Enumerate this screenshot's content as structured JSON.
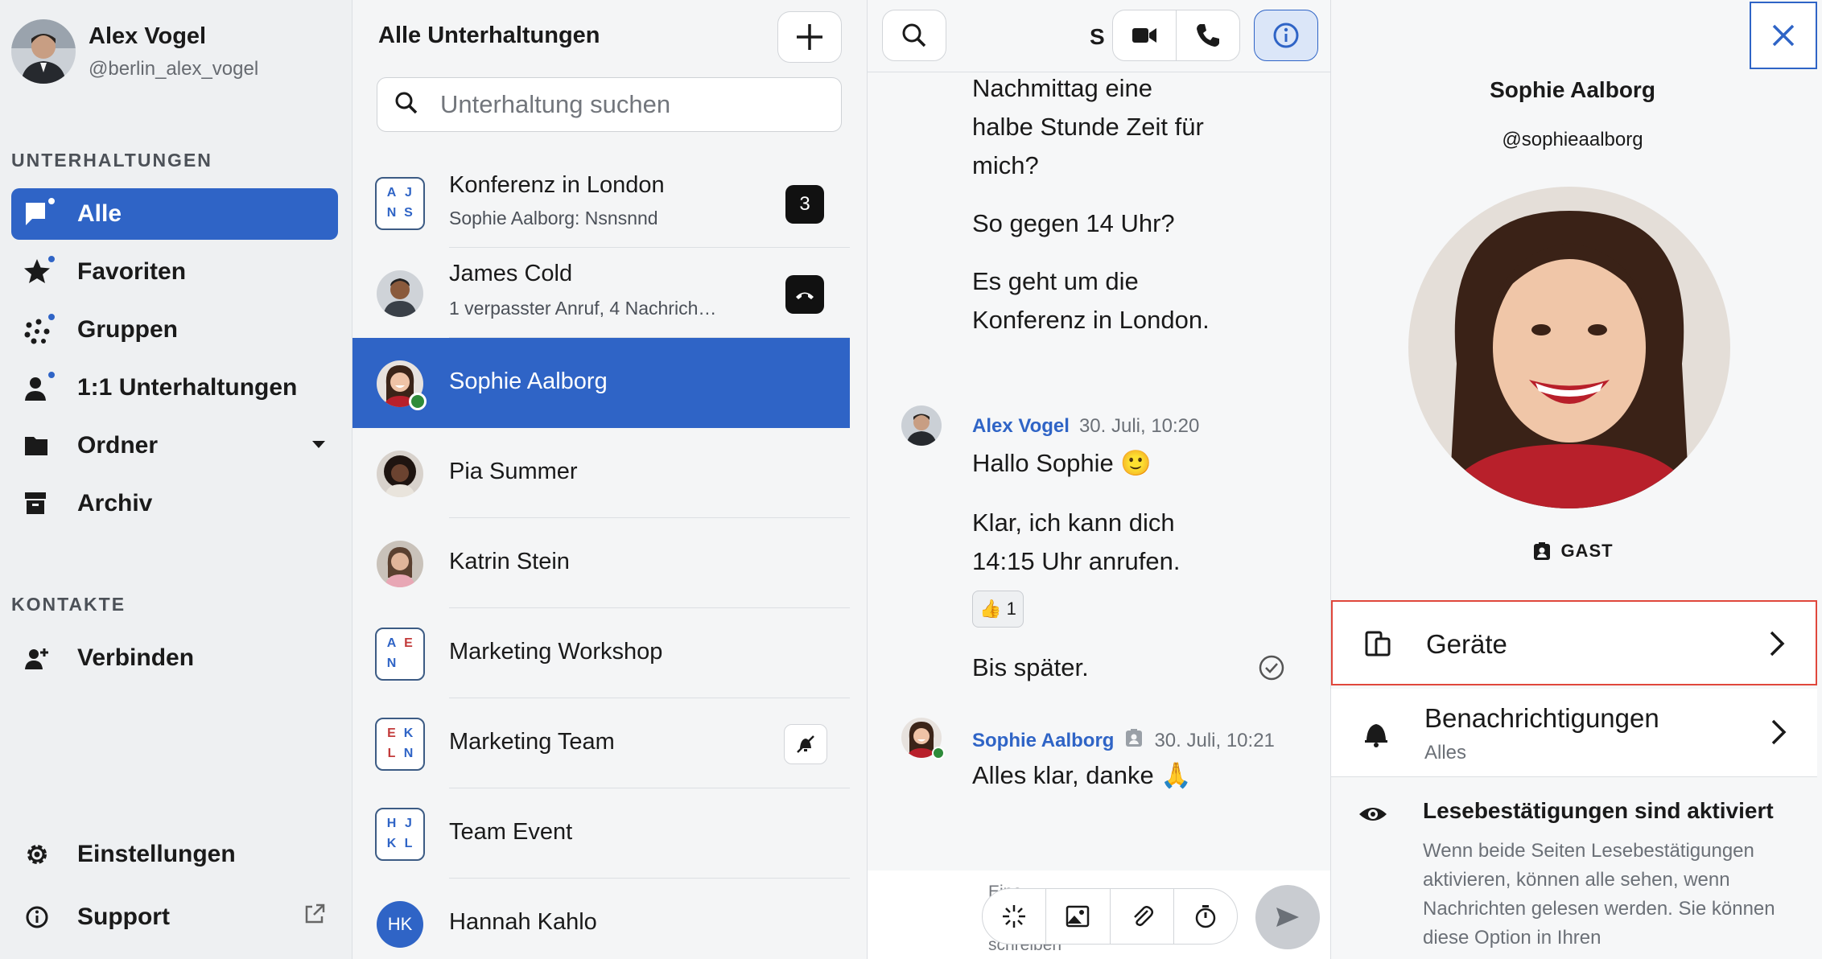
{
  "user": {
    "name": "Alex Vogel",
    "handle": "@berlin_alex_vogel"
  },
  "sidebar": {
    "conversations_label": "UNTERHALTUNGEN",
    "items": [
      {
        "label": "Alle",
        "icon": "chat-bubble-icon"
      },
      {
        "label": "Favoriten",
        "icon": "star-icon"
      },
      {
        "label": "Gruppen",
        "icon": "group-dots-icon"
      },
      {
        "label": "1:1 Unterhaltungen",
        "icon": "person-icon"
      },
      {
        "label": "Ordner",
        "icon": "folder-icon"
      },
      {
        "label": "Archiv",
        "icon": "archive-icon"
      }
    ],
    "contacts_label": "KONTAKTE",
    "connect_label": "Verbinden",
    "settings_label": "Einstellungen",
    "support_label": "Support"
  },
  "conversation_list": {
    "title": "Alle Unterhaltungen",
    "search_placeholder": "Unterhaltung suchen",
    "items": [
      {
        "title": "Konferenz in London",
        "subtitle": "Sophie Aalborg: Nsnsnnd",
        "badge": "3",
        "initials": [
          "A",
          "J",
          "N",
          "S"
        ]
      },
      {
        "title": "James Cold",
        "subtitle": "1 verpasster Anruf, 4 Nachrich…"
      },
      {
        "title": "Sophie Aalborg"
      },
      {
        "title": "Pia Summer"
      },
      {
        "title": "Katrin Stein"
      },
      {
        "title": "Marketing Workshop",
        "initials": [
          "A",
          "E",
          "N",
          ""
        ]
      },
      {
        "title": "Marketing Team",
        "initials": [
          "E",
          "K",
          "L",
          "N"
        ]
      },
      {
        "title": "Team Event",
        "initials": [
          "H",
          "J",
          "K",
          "L"
        ]
      },
      {
        "title": "Hannah Kahlo",
        "avatar_initials": "HK"
      }
    ]
  },
  "chat": {
    "header_name": "S",
    "messages": [
      {
        "lines": [
          "Nachmittag eine",
          "halbe Stunde Zeit für",
          "mich?"
        ]
      },
      {
        "text": "So gegen 14 Uhr?"
      },
      {
        "lines": [
          "Es geht um die",
          "Konferenz in London."
        ]
      },
      {
        "author": "Alex Vogel",
        "time": "30. Juli, 10:20",
        "text": "Hallo Sophie 🙂"
      },
      {
        "lines": [
          "Klar, ich kann dich",
          "14:15 Uhr anrufen."
        ],
        "reaction": "👍",
        "reaction_count": "1"
      },
      {
        "text": "Bis später."
      },
      {
        "author": "Sophie Aalborg",
        "time": "30. Juli, 10:21",
        "text": "Alles klar, danke 🙏"
      }
    ],
    "composer_placeholder": "Eine Nachricht schreiben"
  },
  "details": {
    "name": "Sophie Aalborg",
    "handle": "@sophieaalborg",
    "role": "GAST",
    "devices_label": "Geräte",
    "notifications_label": "Benachrichtigungen",
    "notifications_value": "Alles",
    "read_receipts_title": "Lesebestätigungen sind aktiviert",
    "read_receipts_desc": "Wenn beide Seiten Lesebestätigungen aktivieren, können alle sehen, wenn Nachrichten gelesen werden. Sie können diese Option in Ihren"
  },
  "colors": {
    "accent": "#2f64c6",
    "highlight": "#e0473c",
    "online": "#2e8b3a"
  }
}
